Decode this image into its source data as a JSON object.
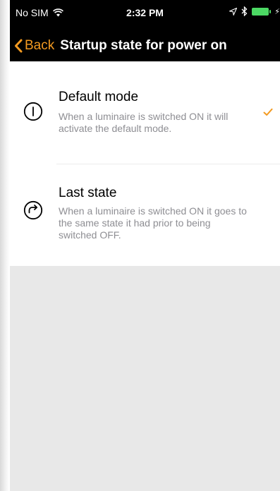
{
  "status_bar": {
    "carrier": "No SIM",
    "time": "2:32 PM",
    "wifi_icon": "wifi-icon",
    "location_icon": "location-arrow-icon",
    "bluetooth_icon": "bluetooth-icon",
    "battery_icon": "battery-icon",
    "charging_icon": "charging-bolt-icon"
  },
  "nav": {
    "back_label": "Back",
    "title": "Startup state for power on",
    "back_icon": "chevron-left-icon"
  },
  "options": [
    {
      "title": "Default mode",
      "description": "When a luminaire is switched ON it will activate the default mode.",
      "icon": "power-icon",
      "selected": true
    },
    {
      "title": "Last state",
      "description": "When a luminaire is switched ON it goes to the same state it had prior to being switched OFF.",
      "icon": "redo-arrow-icon",
      "selected": false
    }
  ],
  "colors": {
    "accent": "#f39a21",
    "nav_background": "#000000",
    "description_text": "#8e8e93",
    "empty_area": "#e8e8e8",
    "battery": "#4cd964"
  }
}
